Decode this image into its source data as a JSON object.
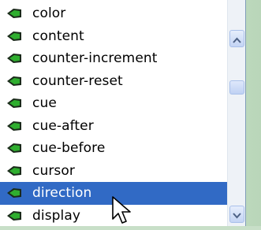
{
  "list": {
    "items": [
      {
        "label": "color",
        "selected": false
      },
      {
        "label": "content",
        "selected": false
      },
      {
        "label": "counter-increment",
        "selected": false
      },
      {
        "label": "counter-reset",
        "selected": false
      },
      {
        "label": "cue",
        "selected": false
      },
      {
        "label": "cue-after",
        "selected": false
      },
      {
        "label": "cue-before",
        "selected": false
      },
      {
        "label": "cursor",
        "selected": false
      },
      {
        "label": "direction",
        "selected": true
      },
      {
        "label": "display",
        "selected": false
      }
    ],
    "item_icon": "property-icon"
  },
  "scrollbar": {
    "up_icon": "chevron-up-icon",
    "down_icon": "chevron-down-icon"
  },
  "colors": {
    "selection": "#316ac5",
    "icon_green": "#1f9a27",
    "icon_dark": "#1a2a1a"
  }
}
